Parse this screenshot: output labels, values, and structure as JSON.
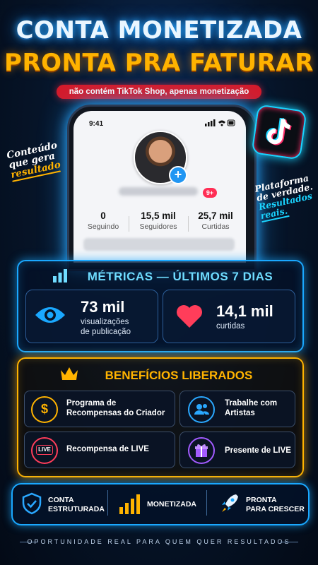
{
  "header": {
    "line1": "CONTA MONETIZADA",
    "line2": "PRONTA PRA FATURAR",
    "note": "não contém TikTok Shop, apenas monetização"
  },
  "phone": {
    "time": "9:41",
    "badge": "9+",
    "stats": [
      {
        "value": "0",
        "label": "Seguindo"
      },
      {
        "value": "15,5 mil",
        "label": "Seguidores"
      },
      {
        "value": "25,7 mil",
        "label": "Curtidas"
      }
    ]
  },
  "side_left": {
    "line1": "Conteúdo",
    "line2": "que gera",
    "line3": "resultado"
  },
  "side_right": {
    "line1": "Plataforma",
    "line2": "de verdade.",
    "line3": "Resultados",
    "line4": "reais."
  },
  "metrics": {
    "title": "MÉTRICAS — ÚLTIMOS 7 DIAS",
    "cards": [
      {
        "value": "73 mil",
        "label1": "visualizações",
        "label2": "de publicação",
        "icon": "eye-icon"
      },
      {
        "value": "14,1 mil",
        "label1": "curtidas",
        "label2": "",
        "icon": "heart-icon"
      }
    ]
  },
  "benefits": {
    "title": "BENEFÍCIOS LIBERADOS",
    "items": [
      {
        "line1": "Programa de",
        "line2": "Recompensas do Criador",
        "icon": "dollar-coin-icon",
        "color": "#ffb300"
      },
      {
        "line1": "Trabalhe com",
        "line2": "Artistas",
        "icon": "people-icon",
        "color": "#2aa8ff"
      },
      {
        "line1": "Recompensa de LIVE",
        "line2": "",
        "icon": "live-icon",
        "color": "#ff3d5a"
      },
      {
        "line1": "Presente de LIVE",
        "line2": "",
        "icon": "gift-icon",
        "color": "#a25bff"
      }
    ]
  },
  "bottom": {
    "items": [
      {
        "line1": "CONTA",
        "line2": "ESTRUTURADA",
        "icon": "shield-check-icon"
      },
      {
        "line1": "MONETIZADA",
        "line2": "",
        "icon": "bars-icon"
      },
      {
        "line1": "PRONTA",
        "line2": "PARA CRESCER",
        "icon": "rocket-icon"
      }
    ]
  },
  "footer": "OPORTUNIDADE REAL PARA QUEM QUER RESULTADOS"
}
